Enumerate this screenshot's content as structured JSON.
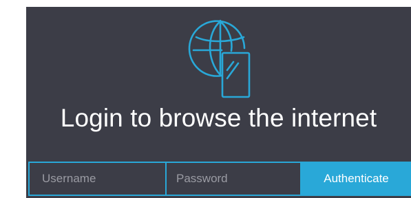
{
  "logo": {
    "icon": "globe-phone-icon",
    "color": "#29a8d8"
  },
  "heading": {
    "text": "Login to browse the internet"
  },
  "login": {
    "username_placeholder": "Username",
    "password_placeholder": "Password",
    "submit_label": "Authenticate"
  },
  "colors": {
    "background": "#3c3d47",
    "accent": "#29a8d8",
    "text": "#ffffff",
    "placeholder": "#9a9ba3"
  }
}
